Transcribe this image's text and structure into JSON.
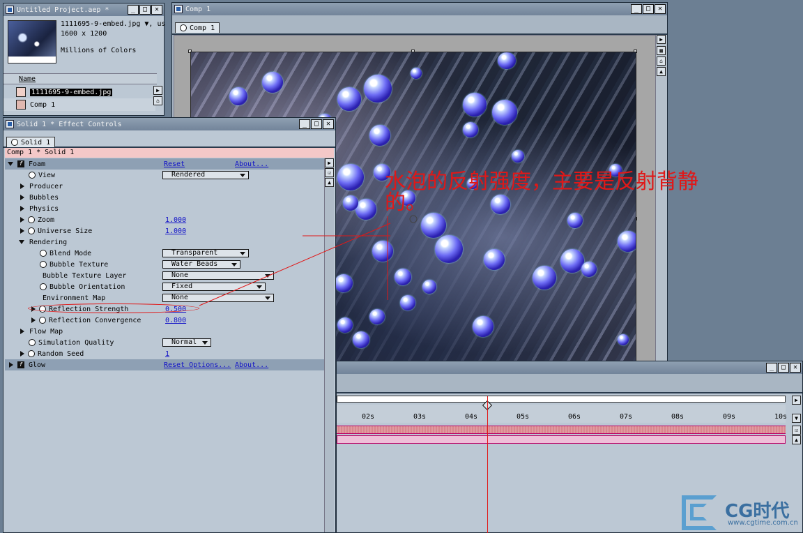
{
  "project": {
    "title": "Untitled Project.aep *",
    "file_name": "1111695-9-embed.jpg ▼, us",
    "dimensions": "1600 x 1200",
    "colors": "Millions of Colors",
    "col_name": "Name",
    "items": [
      {
        "label": "1111695-9-embed.jpg"
      },
      {
        "label": "Comp 1"
      }
    ]
  },
  "comp": {
    "title": "Comp 1",
    "tab": "Comp 1"
  },
  "annotation": {
    "text": "水泡的反射强度，主要是反射背静的。",
    "color": "#e01818"
  },
  "fx": {
    "title": "Solid 1 * Effect Controls",
    "tab": "Solid 1",
    "path": "Comp 1 * Solid 1",
    "foam": {
      "name": "Foam",
      "reset": "Reset",
      "about": "About..."
    },
    "view": {
      "label": "View",
      "value": "Rendered"
    },
    "producer": "Producer",
    "bubbles": "Bubbles",
    "physics": "Physics",
    "zoom": {
      "label": "Zoom",
      "value": "1.000"
    },
    "universe": {
      "label": "Universe Size",
      "value": "1.000"
    },
    "rendering": "Rendering",
    "blend": {
      "label": "Blend Mode",
      "value": "Transparent"
    },
    "texture": {
      "label": "Bubble Texture",
      "value": "Water Beads"
    },
    "tex_layer": {
      "label": "Bubble Texture Layer",
      "value": "None"
    },
    "orientation": {
      "label": "Bubble Orientation",
      "value": "Fixed"
    },
    "env_map": {
      "label": "Environment Map",
      "value": "None"
    },
    "refl_strength": {
      "label": "Reflection Strength",
      "value": "0.500"
    },
    "refl_conv": {
      "label": "Reflection Convergence",
      "value": "0.800"
    },
    "flow_map": "Flow Map",
    "sim_quality": {
      "label": "Simulation Quality",
      "value": "Normal"
    },
    "seed": {
      "label": "Random Seed",
      "value": "1"
    },
    "glow": {
      "name": "Glow",
      "reset": "Reset Options...",
      "about": "About..."
    }
  },
  "timeline": {
    "ticks": [
      "02s",
      "03s",
      "04s",
      "05s",
      "06s",
      "07s",
      "08s",
      "09s",
      "10s"
    ]
  },
  "watermark": {
    "brand": "CG时代",
    "url": "www.cgtime.com.cn"
  },
  "colors": {
    "accent_red": "#e01818",
    "link_blue": "#1010c8",
    "panel": "#bcc8d4"
  }
}
